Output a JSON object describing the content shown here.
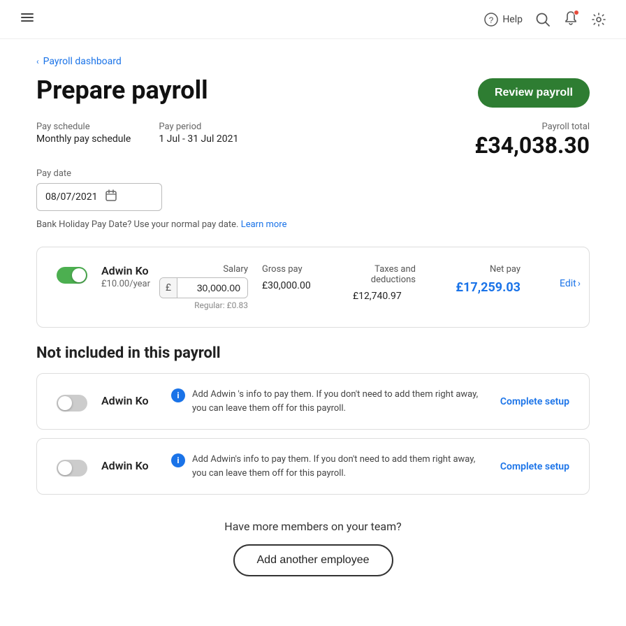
{
  "header": {
    "help_label": "Help",
    "hamburger_aria": "Open menu"
  },
  "breadcrumb": {
    "label": "Payroll dashboard"
  },
  "page": {
    "title": "Prepare payroll",
    "review_button": "Review payroll"
  },
  "pay_info": {
    "schedule_label": "Pay schedule",
    "schedule_value": "Monthly pay schedule",
    "period_label": "Pay period",
    "period_value": "1 Jul - 31 Jul 2021",
    "date_label": "Pay date",
    "date_value": "08/07/2021",
    "total_label": "Payroll total",
    "total_value": "£34,038.30"
  },
  "bank_holiday_note": "Bank Holiday Pay Date? Use your normal pay date.",
  "learn_more": "Learn more",
  "included_employee": {
    "name": "Adwin Ko",
    "rate": "£10.00/year",
    "salary_label": "Salary",
    "salary_currency": "£",
    "salary_value": "30,000.00",
    "salary_regular": "Regular: £0.83",
    "gross_pay_label": "Gross pay",
    "gross_pay_value": "£30,000.00",
    "taxes_label": "Taxes and deductions",
    "taxes_value": "£12,740.97",
    "net_pay_label": "Net pay",
    "net_pay_value": "£17,259.03",
    "edit_label": "Edit"
  },
  "not_included_title": "Not included in this payroll",
  "excluded_employees": [
    {
      "name": "Adwin Ko",
      "message": "Add Adwin 's info to pay them. If you don't need to add them right away, you can leave them off for this payroll.",
      "setup_label": "Complete setup"
    },
    {
      "name": "Adwin Ko",
      "message": "Add Adwin's info to pay them. If you don't need to add them right away, you can leave them off for this payroll.",
      "setup_label": "Complete setup"
    }
  ],
  "bottom_cta": {
    "question": "Have more members on your team?",
    "button_label": "Add another employee"
  }
}
